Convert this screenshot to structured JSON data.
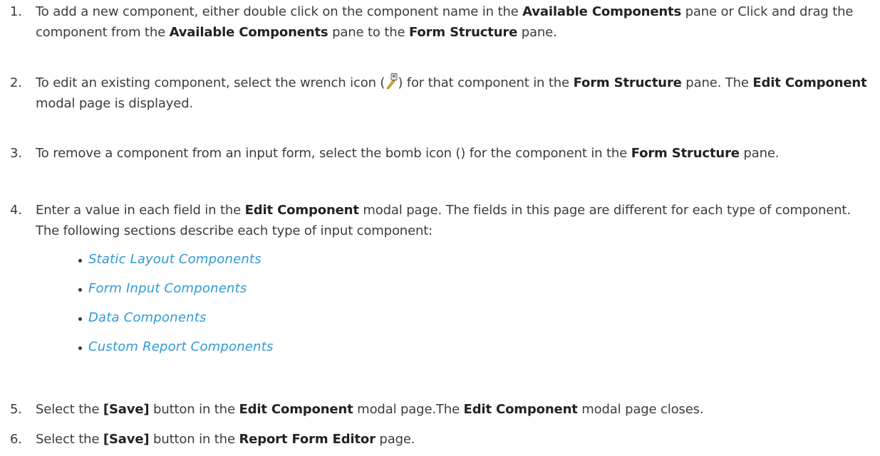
{
  "steps": [
    {
      "num": "1.",
      "parts": [
        "To add a new component, either double click on the component name in the ",
        "Available Components",
        " pane or Click and drag the component from the ",
        "Available Components",
        " pane to the ",
        "Form Structure",
        " pane."
      ]
    },
    {
      "num": "2.",
      "parts": [
        "To edit an existing component, select the wrench icon (",
        ") for that component in the ",
        "Form Structure",
        " pane. The ",
        "Edit Component",
        " modal page is displayed."
      ]
    },
    {
      "num": "3.",
      "parts": [
        "To remove a component from an input form, select the bomb icon () for the component in the ",
        "Form Structure",
        " pane."
      ]
    },
    {
      "num": "4.",
      "parts": [
        "Enter a value in each field in the ",
        "Edit Component",
        " modal page. The fields in this page are different for each type of component. The following sections describe each type of input component:"
      ]
    },
    {
      "num": "5.",
      "parts": [
        "Select the ",
        "[Save]",
        " button in the ",
        "Edit Component",
        " modal page.The ",
        "Edit Component",
        " modal page closes."
      ]
    },
    {
      "num": "6.",
      "parts": [
        "Select the ",
        "[Save]",
        " button in the ",
        "Report Form Editor",
        " page."
      ]
    }
  ],
  "links": [
    "Static Layout Components",
    "Form Input Components",
    "Data Components",
    "Custom Report Components"
  ],
  "icons": {
    "wrench": "wrench-icon",
    "bullet": "bullet-dot"
  },
  "colors": {
    "link": "#2f9ad4",
    "text": "#3c3c3c"
  }
}
